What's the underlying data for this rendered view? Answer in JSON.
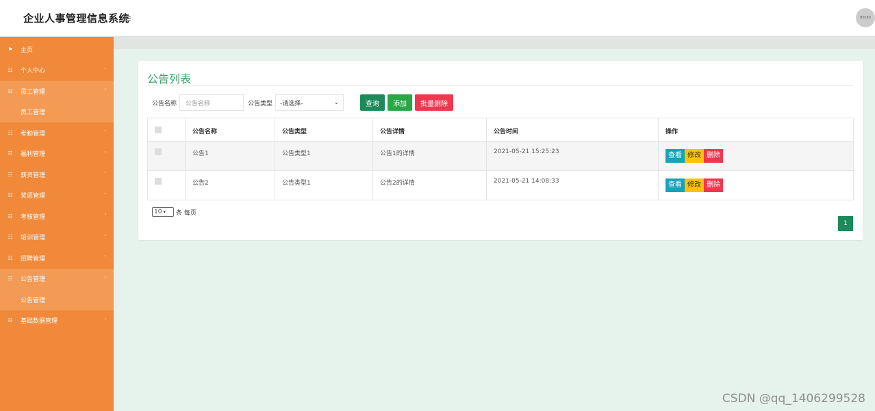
{
  "app": {
    "title": "企业人事管理信息系统",
    "avatar_text": "80x80"
  },
  "sidebar": {
    "items": [
      {
        "label": "主页",
        "icon": "flag-icon",
        "arrow": ""
      },
      {
        "label": "个人中心",
        "icon": "grid-icon",
        "arrow": "˅"
      },
      {
        "label": "员工管理",
        "icon": "grid-icon",
        "arrow": "˄",
        "open": true
      },
      {
        "label": "员工管理",
        "sub": true
      },
      {
        "label": "考勤管理",
        "icon": "grid-icon",
        "arrow": "˅"
      },
      {
        "label": "福利管理",
        "icon": "grid-icon",
        "arrow": "˅"
      },
      {
        "label": "薪资管理",
        "icon": "grid-icon",
        "arrow": "˅"
      },
      {
        "label": "奖惩管理",
        "icon": "grid-icon",
        "arrow": "˅"
      },
      {
        "label": "考核管理",
        "icon": "grid-icon",
        "arrow": "˅"
      },
      {
        "label": "培训管理",
        "icon": "grid-icon",
        "arrow": "˅"
      },
      {
        "label": "招聘管理",
        "icon": "grid-icon",
        "arrow": "˅"
      },
      {
        "label": "公告管理",
        "icon": "grid-icon",
        "arrow": "˄",
        "open": true
      },
      {
        "label": "公告管理",
        "sub": true
      },
      {
        "label": "基础数据管理",
        "icon": "grid-icon",
        "arrow": "˅"
      }
    ]
  },
  "panel": {
    "title": "公告列表",
    "search": {
      "name_label": "公告名称",
      "name_placeholder": "公告名称",
      "type_label": "公告类型",
      "type_selected": "-请选择-",
      "query_button": "查询",
      "add_button": "添加",
      "batch_delete_button": "批量删除"
    },
    "table": {
      "headers": [
        "公告名称",
        "公告类型",
        "公告详情",
        "公告时间",
        "操作"
      ],
      "rows": [
        {
          "name": "公告1",
          "type": "公告类型1",
          "detail": "公告1的详情",
          "time": "2021-05-21 15:25:23"
        },
        {
          "name": "公告2",
          "type": "公告类型1",
          "detail": "公告2的详情",
          "time": "2021-05-21 14:08:33"
        }
      ],
      "actions": {
        "view": "查看",
        "edit": "修改",
        "delete": "删除"
      }
    },
    "pager": {
      "page_size": "10",
      "page_size_suffix": "条 每页",
      "current_page": "1"
    }
  },
  "watermark": "CSDN @qq_1406299528",
  "colors": {
    "sidebar": "#f0893a",
    "accent_green": "#1c8a5a",
    "title_green": "#3aa36c",
    "danger": "#f2364e",
    "info": "#17a2b8",
    "warning": "#ffc107"
  }
}
